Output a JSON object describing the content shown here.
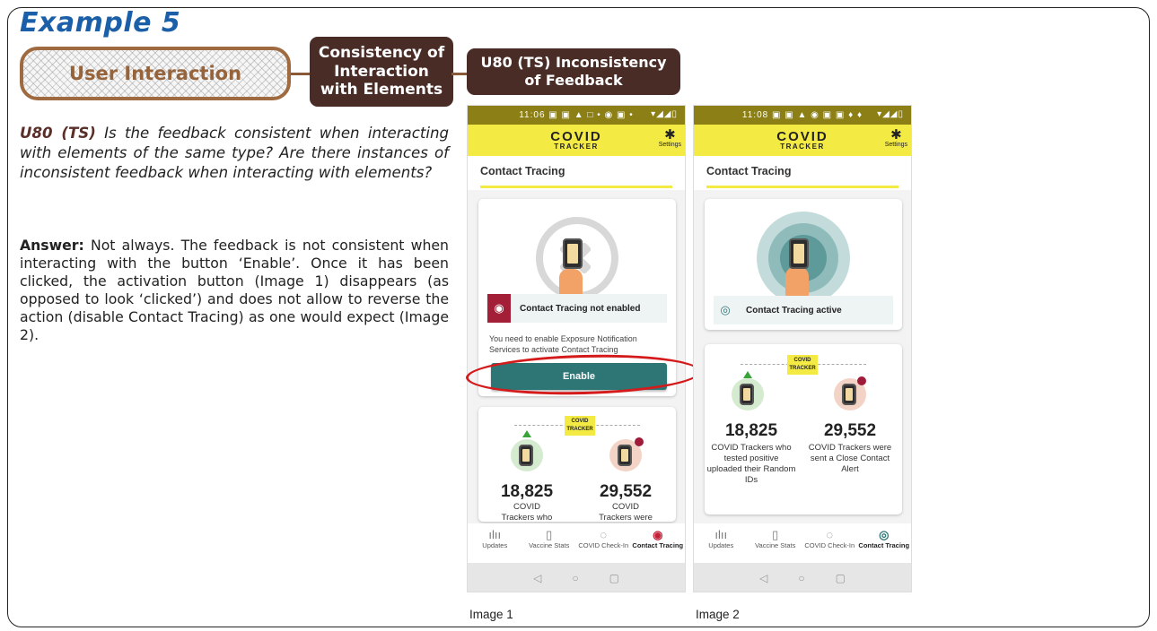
{
  "title": "Example 5",
  "header": {
    "category": "User Interaction",
    "subcategory": "Consistency of Interaction with Elements",
    "criterion": "U80 (TS) Inconsistency of Feedback"
  },
  "question": {
    "code": "U80 (TS)",
    "text": "Is the feedback consistent when interacting with elements of the same type? Are there instances of inconsistent feedback when interacting with elements?"
  },
  "answer": {
    "label": "Answer:",
    "text": "Not always. The feedback is not consistent when interacting with the button ‘Enable’. Once it has been clicked, the activation button (Image 1) disappears (as opposed to look ‘clicked’) and does not allow to reverse the action (disable Contact Tracing) as one would expect (Image 2)."
  },
  "phone1": {
    "status_time": "11:06",
    "status_icons": "▣ ▣ ▲ □ • ◉ ▣ •",
    "status_right": "▾◢◢▯",
    "logo_main": "COVID",
    "logo_sub": "TRACKER",
    "settings_label": "Settings",
    "section_title": "Contact Tracing",
    "status_text": "Contact Tracing not enabled",
    "note": "You need to enable Exposure Notification Services to activate Contact Tracing",
    "enable_label": "Enable",
    "stat1_num": "18,825",
    "stat1_label": "COVID",
    "stat1_label2": "Trackers who",
    "stat2_num": "29,552",
    "stat2_label": "COVID",
    "stat2_label2": "Trackers were",
    "badge": "COVID TRACKER"
  },
  "phone2": {
    "status_time": "11:08",
    "status_icons": "▣ ▣ ▲ ◉ ▣ ▣ ♦ ♦",
    "status_right": "▾◢◢▯",
    "logo_main": "COVID",
    "logo_sub": "TRACKER",
    "settings_label": "Settings",
    "section_title": "Contact Tracing",
    "status_text": "Contact Tracing active",
    "stat1_num": "18,825",
    "stat1_label": "COVID Trackers who tested positive uploaded their Random IDs",
    "stat2_num": "29,552",
    "stat2_label": "COVID Trackers were sent a Close Contact Alert",
    "badge": "COVID TRACKER"
  },
  "nav": {
    "updates": "Updates",
    "vaccine": "Vaccine Stats",
    "checkin": "COVID Check-In",
    "tracing": "Contact Tracing"
  },
  "captions": {
    "image1": "Image 1",
    "image2": "Image 2"
  },
  "colors": {
    "title_blue": "#1b5fa8",
    "pill_dark": "#4a2c27",
    "app_yellow": "#f3ea44",
    "teal": "#2e7675",
    "highlight_red": "#d41a1a"
  }
}
